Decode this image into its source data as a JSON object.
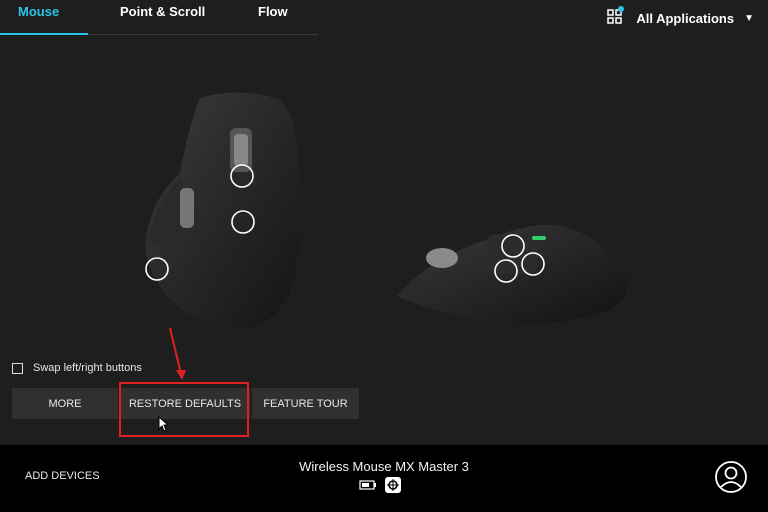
{
  "tabs": [
    {
      "label": "Mouse",
      "active": true
    },
    {
      "label": "Point & Scroll",
      "active": false
    },
    {
      "label": "Flow",
      "active": false
    }
  ],
  "app_selector": {
    "label": "All Applications",
    "icon": "apps-grid-icon"
  },
  "options": {
    "swap_label": "Swap left/right buttons",
    "swap_checked": false
  },
  "buttons": {
    "more": "MORE",
    "restore": "RESTORE DEFAULTS",
    "tour": "FEATURE TOUR"
  },
  "footer": {
    "add_devices": "ADD DEVICES",
    "device_name": "Wireless Mouse MX Master 3",
    "battery_icon": "battery-icon",
    "receiver_icon": "unifying-receiver-icon",
    "account_icon": "account-icon"
  },
  "colors": {
    "accent": "#29c5e8",
    "highlight": "#e02020",
    "background": "#1e1e1e",
    "footer": "#000000"
  }
}
